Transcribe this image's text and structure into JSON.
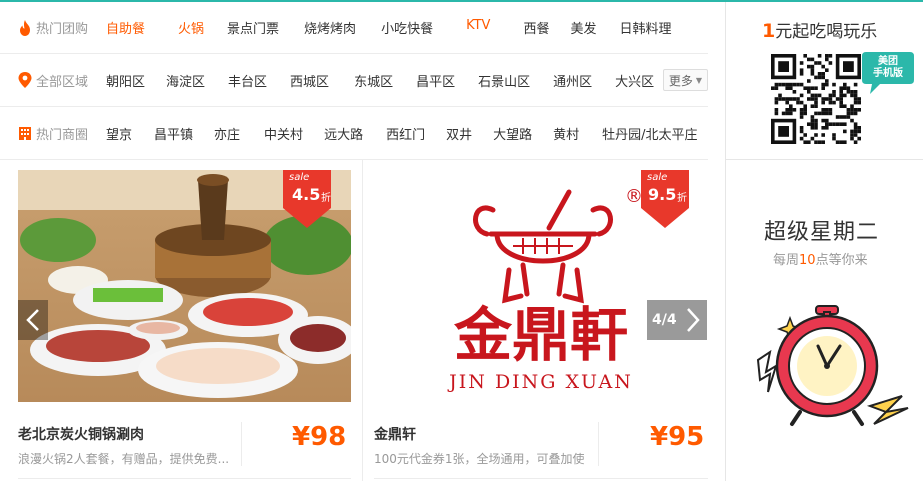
{
  "filters": {
    "row1": {
      "label": "热门团购",
      "items": [
        {
          "text": "自助餐",
          "hot": true
        },
        {
          "text": "火锅",
          "hot": true
        },
        {
          "text": "景点门票",
          "hot": false
        },
        {
          "text": "烧烤烤肉",
          "hot": false
        },
        {
          "text": "小吃快餐",
          "hot": false
        },
        {
          "text": "KTV",
          "hot": true
        },
        {
          "text": "西餐",
          "hot": false
        },
        {
          "text": "美发",
          "hot": false
        },
        {
          "text": "日韩料理",
          "hot": false
        }
      ]
    },
    "row2": {
      "label": "全部区域",
      "items": [
        "朝阳区",
        "海淀区",
        "丰台区",
        "西城区",
        "东城区",
        "昌平区",
        "石景山区",
        "通州区",
        "大兴区"
      ],
      "more": "更多"
    },
    "row3": {
      "label": "热门商圈",
      "items": [
        "望京",
        "昌平镇",
        "亦庄",
        "中关村",
        "远大路",
        "西红门",
        "双井",
        "大望路",
        "黄村",
        "牡丹园/北太平庄"
      ]
    }
  },
  "promo": {
    "num": "1",
    "title_rest": "元起吃喝玩乐",
    "badge_line1": "美团",
    "badge_line2": "手机版"
  },
  "tuesday": {
    "title": "超级星期二",
    "sub_pre": "每周",
    "sub_num": "10",
    "sub_post": "点等你来"
  },
  "deals": [
    {
      "name": "老北京炭火铜锅涮肉",
      "desc": "浪漫火锅2人套餐，有赠品，提供免费...",
      "price": "¥98",
      "sale_word": "sale",
      "discount": "4.5",
      "discount_unit": "折"
    },
    {
      "name": "金鼎轩",
      "desc": "100元代金券1张，全场通用，可叠加使...",
      "price": "¥95",
      "sale_word": "sale",
      "discount": "9.5",
      "discount_unit": "折",
      "logo_text": "金鼎軒",
      "logo_pinyin": "JIN DING XUAN",
      "logo_reg": "®"
    }
  ],
  "carousel": {
    "pager": "4/4"
  },
  "colors": {
    "accent": "#ff5a00",
    "teal": "#2bb8aa",
    "logo_red": "#c8161d",
    "sale_red": "#e8382b"
  }
}
